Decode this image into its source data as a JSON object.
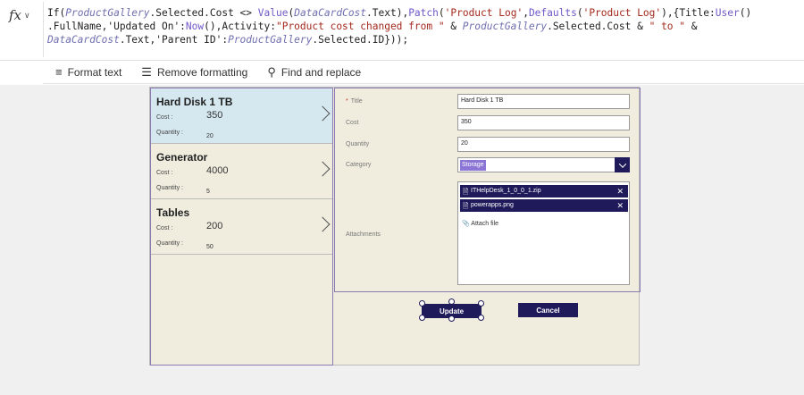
{
  "formula": {
    "fx_label": "fx",
    "tokens": [
      {
        "text": "If(",
        "c": "plain"
      },
      {
        "text": "ProductGallery",
        "c": "id"
      },
      {
        "text": ".Selected.Cost <> ",
        "c": "plain"
      },
      {
        "text": "Value",
        "c": "fn"
      },
      {
        "text": "(",
        "c": "plain"
      },
      {
        "text": "DataCardCost",
        "c": "id"
      },
      {
        "text": ".Text),",
        "c": "plain"
      },
      {
        "text": "Patch",
        "c": "fn"
      },
      {
        "text": "(",
        "c": "plain"
      },
      {
        "text": "'Product Log'",
        "c": "str"
      },
      {
        "text": ",",
        "c": "plain"
      },
      {
        "text": "Defaults",
        "c": "fn"
      },
      {
        "text": "(",
        "c": "plain"
      },
      {
        "text": "'Product Log'",
        "c": "str"
      },
      {
        "text": "),{Title:",
        "c": "plain"
      },
      {
        "text": "User",
        "c": "fn"
      },
      {
        "text": "()",
        "c": "plain"
      },
      {
        "text": "\n",
        "c": "plain"
      },
      {
        "text": ".FullName,'Updated On':",
        "c": "plain"
      },
      {
        "text": "Now",
        "c": "fn"
      },
      {
        "text": "(),Activity:",
        "c": "plain"
      },
      {
        "text": "\"Product cost changed from \"",
        "c": "str"
      },
      {
        "text": " & ",
        "c": "plain"
      },
      {
        "text": "ProductGallery",
        "c": "id"
      },
      {
        "text": ".Selected.Cost & ",
        "c": "plain"
      },
      {
        "text": "\" to \"",
        "c": "str"
      },
      {
        "text": " &",
        "c": "plain"
      },
      {
        "text": "\n",
        "c": "plain"
      },
      {
        "text": "DataCardCost",
        "c": "id"
      },
      {
        "text": ".Text,'Parent ID':",
        "c": "plain"
      },
      {
        "text": "ProductGallery",
        "c": "id"
      },
      {
        "text": ".Selected.ID}));",
        "c": "plain"
      }
    ]
  },
  "toolbar": {
    "format_text": "Format text",
    "remove_formatting": "Remove formatting",
    "find_replace": "Find and replace"
  },
  "gallery": {
    "items": [
      {
        "title": "Hard Disk 1 TB",
        "cost_label": "Cost :",
        "cost": "350",
        "qty_label": "Quantity :",
        "qty": "20"
      },
      {
        "title": "Generator",
        "cost_label": "Cost :",
        "cost": "4000",
        "qty_label": "Quantity :",
        "qty": "5"
      },
      {
        "title": "Tables",
        "cost_label": "Cost :",
        "cost": "200",
        "qty_label": "Quantity :",
        "qty": "50"
      }
    ]
  },
  "form": {
    "title_label": "Title",
    "title_value": "Hard Disk 1 TB",
    "cost_label": "Cost",
    "cost_value": "350",
    "quantity_label": "Quantity",
    "quantity_value": "20",
    "category_label": "Category",
    "category_value": "Storage",
    "attachments_label": "Attachments",
    "attachments": [
      "ITHelpDesk_1_0_0_1.zip",
      "powerapps.png"
    ],
    "attach_link": "Attach file"
  },
  "buttons": {
    "update": "Update",
    "cancel": "Cancel"
  }
}
